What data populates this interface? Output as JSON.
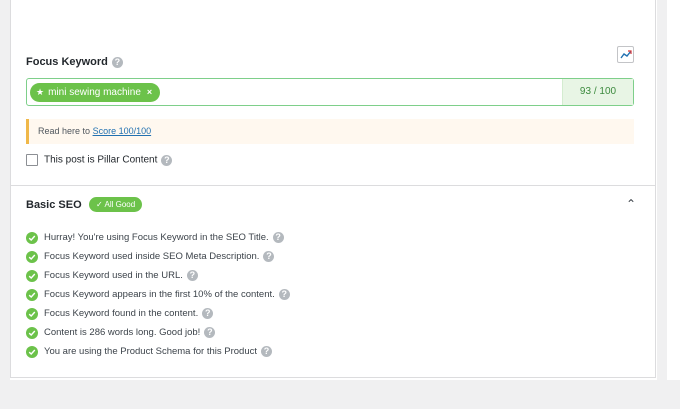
{
  "focus_keyword": {
    "label": "Focus Keyword",
    "help_icon": "question-icon",
    "trend_icon": "trend-chart-icon",
    "keyword": "mini sewing machine",
    "keyword_icon": "star-icon",
    "remove_icon": "close-icon",
    "score": "93 / 100"
  },
  "notice": {
    "prefix": "Read here to",
    "link": "Score 100/100"
  },
  "pillar": {
    "label": "This post is Pillar Content",
    "checked": false
  },
  "basic_seo": {
    "title": "Basic SEO",
    "badge": "✓ All Good",
    "collapse_icon": "chevron-up-icon",
    "checks": [
      "Hurray! You're using Focus Keyword in the SEO Title.",
      "Focus Keyword used inside SEO Meta Description.",
      "Focus Keyword used in the URL.",
      "Focus Keyword appears in the first 10% of the content.",
      "Focus Keyword found in the content.",
      "Content is 286 words long. Good job!",
      "You are using the Product Schema for this Product"
    ]
  },
  "colors": {
    "accent_green": "#6cc24a",
    "score_text": "#3c8a3e",
    "notice_border": "#f0b849",
    "link": "#2271b1"
  }
}
